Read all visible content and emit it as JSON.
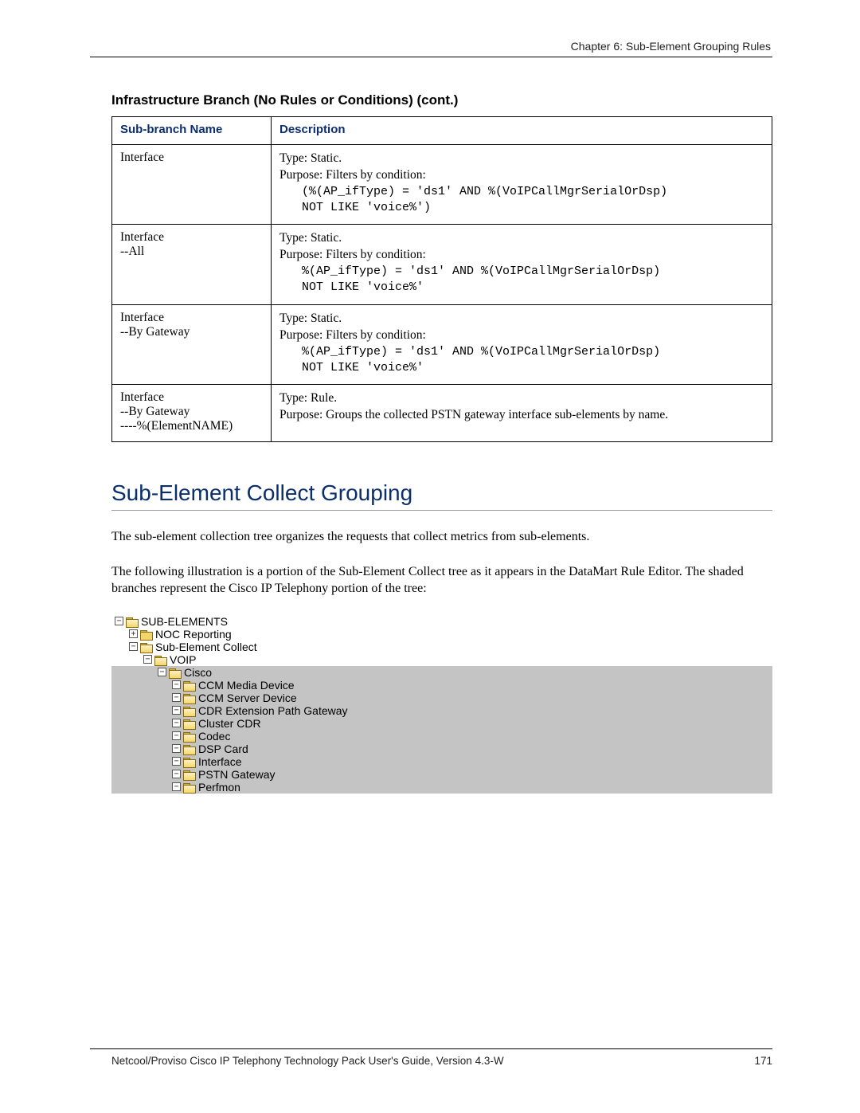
{
  "running_head": "Chapter 6: Sub-Element Grouping Rules",
  "section_title": "Infrastructure Branch (No Rules or Conditions)  (cont.)",
  "table": {
    "headers": [
      "Sub-branch Name",
      "Description"
    ],
    "rows": [
      {
        "name": "Interface",
        "type_line": "Type: Static.",
        "purpose_line": "Purpose: Filters by condition:",
        "code": "(%(AP_ifType) = 'ds1' AND %(VoIPCallMgrSerialOrDsp)\nNOT LIKE 'voice%')"
      },
      {
        "name": "Interface\n--All",
        "type_line": "Type: Static.",
        "purpose_line": "Purpose: Filters by condition:",
        "code": "%(AP_ifType) = 'ds1' AND %(VoIPCallMgrSerialOrDsp)\nNOT LIKE 'voice%'"
      },
      {
        "name": "Interface\n--By Gateway",
        "type_line": "Type: Static.",
        "purpose_line": "Purpose: Filters by condition:",
        "code": "%(AP_ifType) = 'ds1' AND %(VoIPCallMgrSerialOrDsp)\nNOT LIKE 'voice%'"
      },
      {
        "name": "Interface\n--By Gateway\n----%(ElementNAME)",
        "type_line": "Type: Rule.",
        "purpose_line": "Purpose: Groups the collected PSTN gateway interface sub-elements by name.",
        "code": ""
      }
    ]
  },
  "h2": "Sub-Element Collect Grouping",
  "para1": "The sub-element collection tree organizes the requests that collect metrics from sub-elements.",
  "para2": "The following illustration is a portion of the Sub-Element Collect tree as it appears in the DataMart Rule Editor. The shaded branches represent the Cisco IP Telephony portion of the tree:",
  "tree": [
    {
      "indent": 0,
      "toggle": "−",
      "open": true,
      "label": "SUB-ELEMENTS",
      "shaded": false
    },
    {
      "indent": 1,
      "toggle": "+",
      "open": false,
      "label": "NOC Reporting",
      "shaded": false
    },
    {
      "indent": 1,
      "toggle": "−",
      "open": true,
      "label": "Sub-Element Collect",
      "shaded": false
    },
    {
      "indent": 2,
      "toggle": "−",
      "open": true,
      "label": "VOIP",
      "shaded": false
    },
    {
      "indent": 3,
      "toggle": "−",
      "open": true,
      "label": "Cisco",
      "shaded": true
    },
    {
      "indent": 4,
      "toggle": "−",
      "open": true,
      "label": "CCM Media Device",
      "shaded": true
    },
    {
      "indent": 4,
      "toggle": "−",
      "open": true,
      "label": "CCM Server Device",
      "shaded": true
    },
    {
      "indent": 4,
      "toggle": "−",
      "open": true,
      "label": "CDR Extension Path Gateway",
      "shaded": true
    },
    {
      "indent": 4,
      "toggle": "−",
      "open": true,
      "label": "Cluster CDR",
      "shaded": true
    },
    {
      "indent": 4,
      "toggle": "−",
      "open": true,
      "label": "Codec",
      "shaded": true
    },
    {
      "indent": 4,
      "toggle": "−",
      "open": true,
      "label": "DSP Card",
      "shaded": true
    },
    {
      "indent": 4,
      "toggle": "−",
      "open": true,
      "label": "Interface",
      "shaded": true
    },
    {
      "indent": 4,
      "toggle": "−",
      "open": true,
      "label": "PSTN Gateway",
      "shaded": true
    },
    {
      "indent": 4,
      "toggle": "−",
      "open": true,
      "label": "Perfmon",
      "shaded": true
    }
  ],
  "footer_left": "Netcool/Proviso Cisco IP Telephony Technology Pack User's Guide, Version 4.3-W",
  "footer_right": "171"
}
